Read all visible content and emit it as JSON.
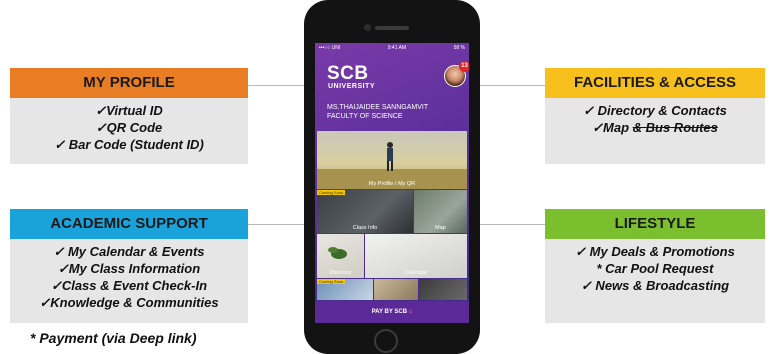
{
  "colors": {
    "my_profile": "#e87d24",
    "facilities_access": "#f7bf1c",
    "academic_support": "#1aa3da",
    "lifestyle": "#7bbf2f",
    "box_body": "#e6e6e6",
    "screen_purple": "#5a2f9a"
  },
  "my_profile": {
    "title": "MY PROFILE",
    "items": [
      "✓Virtual ID",
      "✓QR Code",
      "✓ Bar Code (Student ID)"
    ]
  },
  "academic_support": {
    "title": "ACADEMIC SUPPORT",
    "items": [
      "✓ My Calendar & Events",
      "✓My Class Information",
      "✓Class & Event Check-In",
      "✓Knowledge & Communities"
    ]
  },
  "facilities_access": {
    "title": "FACILITIES & ACCESS",
    "items": [
      "✓ Directory & Contacts"
    ],
    "map_item": {
      "prefix": "✓Map ",
      "struck": "& Bus Routes"
    }
  },
  "lifestyle": {
    "title": "LIFESTYLE",
    "items": [
      "✓ My Deals & Promotions",
      "* Car Pool Request",
      "✓ News & Broadcasting"
    ]
  },
  "footnote": "* Payment (via Deep link)",
  "phone": {
    "status_left": "•••○○ UNI",
    "status_time": "9:41 AM",
    "status_right": "58 %",
    "brand": "SCB",
    "brand_sub": "UNIVERSITY",
    "badge_count": "13",
    "user_name": "MS.THAIJAIDEE SANNGAMVIT",
    "faculty": "FACULTY OF SCIENCE",
    "tiles": {
      "profile": "My Profile / My QR",
      "class_info": "Class Info",
      "map": "Map",
      "directory": "Directory",
      "calendar": "Calendar",
      "coming_soon": "Coming Soon"
    },
    "pay_label": "PAY BY SCB"
  }
}
